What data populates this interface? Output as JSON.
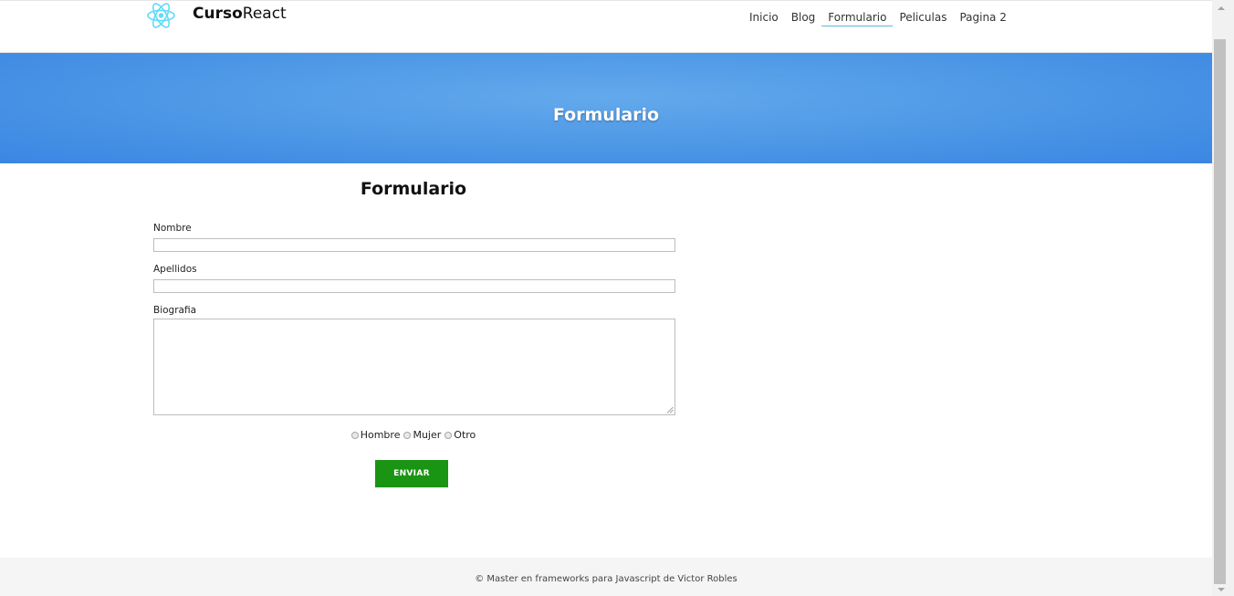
{
  "header": {
    "brand_bold": "Curso",
    "brand_light": "React",
    "nav": [
      "Inicio",
      "Blog",
      "Formulario",
      "Peliculas",
      "Pagina 2"
    ],
    "active_nav": "Formulario"
  },
  "banner": {
    "title": "Formulario"
  },
  "form": {
    "title": "Formulario",
    "nombre_label": "Nombre",
    "nombre_value": "",
    "apellidos_label": "Apellidos",
    "apellidos_value": "",
    "biografia_label": "Biografia",
    "biografia_value": "",
    "gender_options": [
      "Hombre",
      "Mujer",
      "Otro"
    ],
    "submit_label": "ENVIAR"
  },
  "footer": {
    "text": "© Master en frameworks para Javascript de Victor Robles"
  },
  "colors": {
    "banner": "#4e98e6",
    "submit": "#1a9413",
    "active_underline": "#5fb8d6",
    "react_logo": "#61dafb"
  },
  "icons": [
    "react-logo-icon",
    "scroll-up-arrow-icon",
    "scroll-down-arrow-icon",
    "resize-grip-icon"
  ]
}
